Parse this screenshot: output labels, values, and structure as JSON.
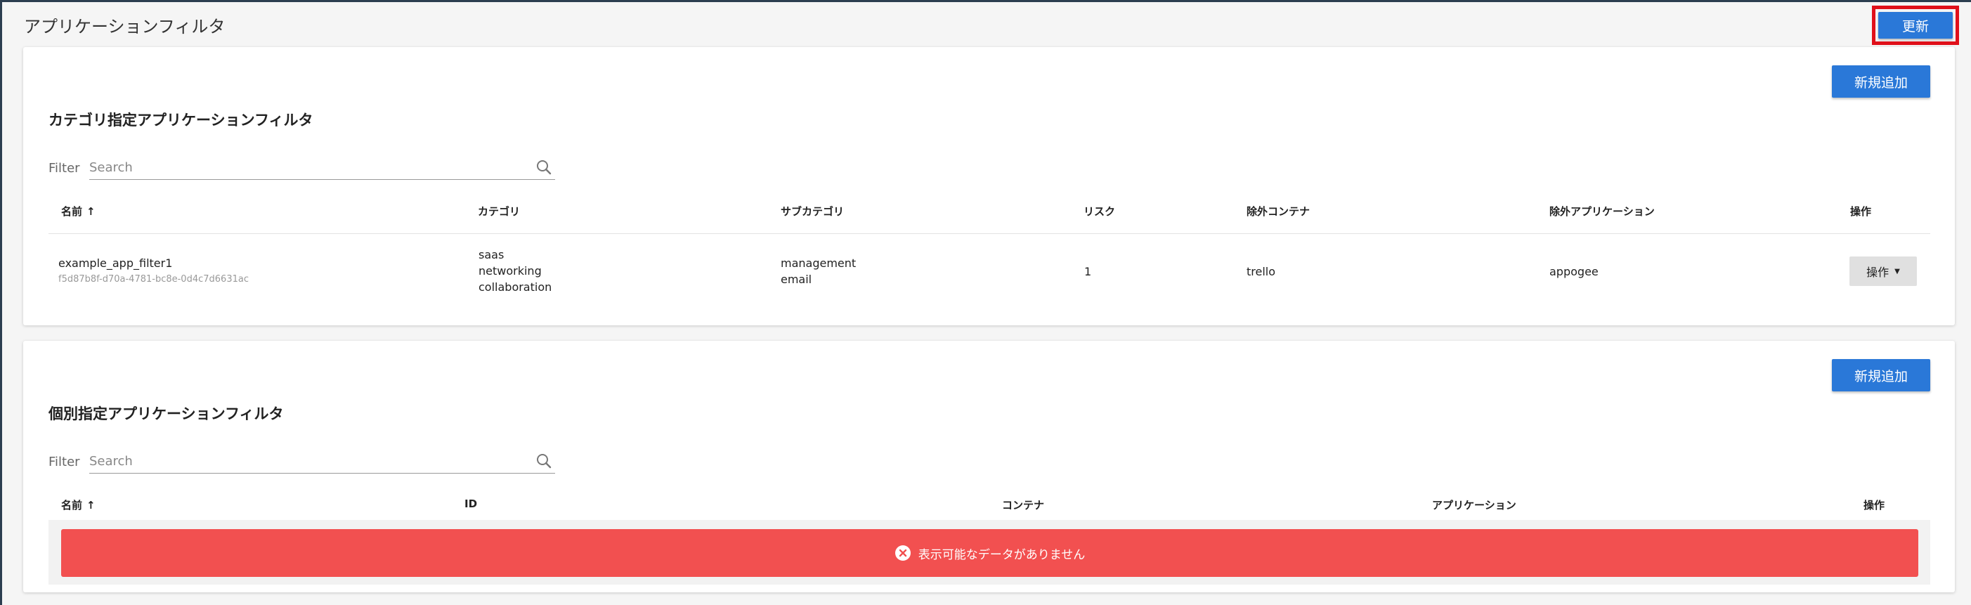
{
  "page": {
    "title": "アプリケーションフィルタ",
    "refresh_label": "更新"
  },
  "category_section": {
    "title": "カテゴリ指定アプリケーションフィルタ",
    "add_label": "新規追加",
    "filter_label": "Filter",
    "search_placeholder": "Search",
    "columns": {
      "name": "名前",
      "category": "カテゴリ",
      "subcategory": "サブカテゴリ",
      "risk": "リスク",
      "excluded_container": "除外コンテナ",
      "excluded_app": "除外アプリケーション",
      "ops": "操作"
    },
    "rows": [
      {
        "name": "example_app_filter1",
        "id": "f5d87b8f-d70a-4781-bc8e-0d4c7d6631ac",
        "categories": [
          "saas",
          "networking",
          "collaboration"
        ],
        "subcategories": [
          "management",
          "email"
        ],
        "risk": "1",
        "excluded_container": "trello",
        "excluded_app": "appogee",
        "ops_label": "操作"
      }
    ]
  },
  "individual_section": {
    "title": "個別指定アプリケーションフィルタ",
    "add_label": "新規追加",
    "filter_label": "Filter",
    "search_placeholder": "Search",
    "columns": {
      "name": "名前",
      "id": "ID",
      "container": "コンテナ",
      "application": "アプリケーション",
      "ops": "操作"
    },
    "empty_message": "表示可能なデータがありません"
  },
  "colors": {
    "primary": "#2a78d8",
    "error": "#f25050",
    "highlight": "#e0101a"
  }
}
